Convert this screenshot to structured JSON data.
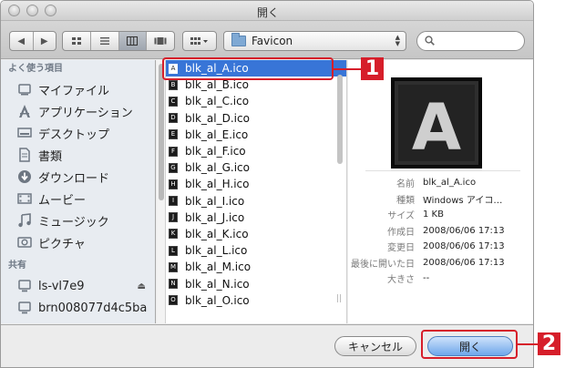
{
  "window": {
    "title": "開く"
  },
  "toolbar": {
    "back_glyph": "◀",
    "forward_glyph": "▶",
    "path_label": "Favicon",
    "search_placeholder": ""
  },
  "sidebar": {
    "sections": [
      {
        "heading": "よく使う項目",
        "items": [
          {
            "label": "マイファイル",
            "icon": "all-my-files-icon"
          },
          {
            "label": "アプリケーション",
            "icon": "applications-icon"
          },
          {
            "label": "デスクトップ",
            "icon": "desktop-icon"
          },
          {
            "label": "書類",
            "icon": "documents-icon"
          },
          {
            "label": "ダウンロード",
            "icon": "downloads-icon"
          },
          {
            "label": "ムービー",
            "icon": "movies-icon"
          },
          {
            "label": "ミュージック",
            "icon": "music-icon"
          },
          {
            "label": "ピクチャ",
            "icon": "pictures-icon"
          }
        ]
      },
      {
        "heading": "共有",
        "items": [
          {
            "label": "ls-vl7e9",
            "icon": "computer-icon",
            "eject": "⏏"
          },
          {
            "label": "brn008077d4c5ba",
            "icon": "computer-icon"
          }
        ]
      }
    ]
  },
  "files": [
    {
      "name": "blk_al_A.ico",
      "glyph": "A",
      "selected": true
    },
    {
      "name": "blk_al_B.ico",
      "glyph": "B"
    },
    {
      "name": "blk_al_C.ico",
      "glyph": "C"
    },
    {
      "name": "blk_al_D.ico",
      "glyph": "D"
    },
    {
      "name": "blk_al_E.ico",
      "glyph": "E"
    },
    {
      "name": "blk_al_F.ico",
      "glyph": "F"
    },
    {
      "name": "blk_al_G.ico",
      "glyph": "G"
    },
    {
      "name": "blk_al_H.ico",
      "glyph": "H"
    },
    {
      "name": "blk_al_I.ico",
      "glyph": "I"
    },
    {
      "name": "blk_al_J.ico",
      "glyph": "J"
    },
    {
      "name": "blk_al_K.ico",
      "glyph": "K"
    },
    {
      "name": "blk_al_L.ico",
      "glyph": "L"
    },
    {
      "name": "blk_al_M.ico",
      "glyph": "M"
    },
    {
      "name": "blk_al_N.ico",
      "glyph": "N"
    },
    {
      "name": "blk_al_O.ico",
      "glyph": "O"
    }
  ],
  "preview": {
    "image_letter": "A",
    "meta": [
      {
        "key": "名前",
        "value": "blk_al_A.ico"
      },
      {
        "key": "種類",
        "value": "Windows アイコ…"
      },
      {
        "key": "サイズ",
        "value": "1 KB"
      },
      {
        "key": "作成日",
        "value": "2008/06/06 17:13"
      },
      {
        "key": "変更日",
        "value": "2008/06/06 17:13"
      },
      {
        "key": "最後に開いた日",
        "value": "2008/06/06 17:13"
      },
      {
        "key": "大きさ",
        "value": "--"
      }
    ]
  },
  "buttons": {
    "cancel": "キャンセル",
    "open": "開く"
  },
  "callouts": [
    "1",
    "2"
  ],
  "colors": {
    "selection": "#3875d7",
    "callout": "#d61e2a"
  }
}
